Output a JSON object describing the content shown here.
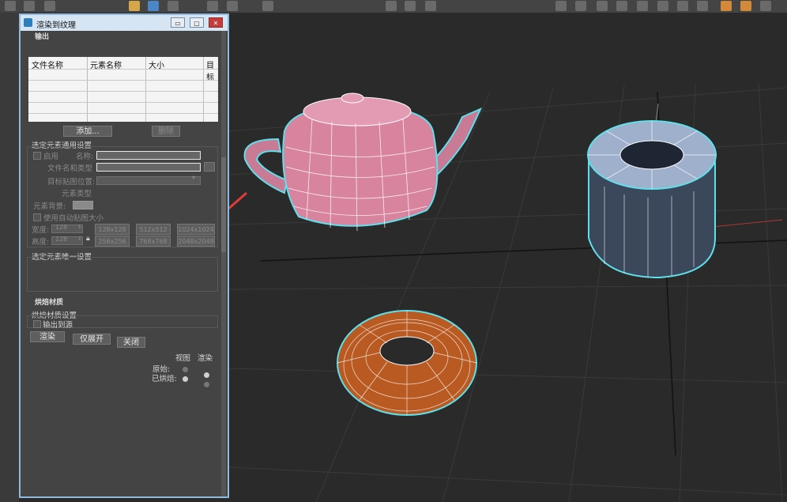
{
  "viewport": {
    "label": "[+]"
  },
  "dialog": {
    "title": "渲染到纹理",
    "minimize_glyph": "▭",
    "maximize_glyph": "▢",
    "close_glyph": "✕",
    "rollout_output": "输出",
    "table": {
      "headers": [
        "文件名称",
        "元素名称",
        "大小",
        "目标"
      ]
    },
    "add_button": "添加...",
    "delete_button": "删除",
    "common_settings": "选定元素通用设置",
    "enable_label": "启用",
    "name_label": "名称:",
    "file_name_type_label": "文件名和类型",
    "target_map_slot_label": "目标贴图位置:",
    "element_type_label": "元素类型",
    "element_bg_label": "元素背景:",
    "auto_map_size_label": "使用自动贴图大小",
    "width_label": "宽度:",
    "height_label": "高度:",
    "width_value": "128",
    "height_value": "128",
    "size_presets_row1": [
      "128x128",
      "512x512",
      "1024x1024"
    ],
    "size_presets_row2": [
      "256x256",
      "768x768",
      "2048x2048"
    ],
    "unique_settings": "选定元素唯一设置",
    "rollout_baked_material": "烘焙材质",
    "baked_material_settings": "烘焙材质设置",
    "output_to_source": "输出到源",
    "render_button": "渲染",
    "unwrap_only_button": "仅展开",
    "close_button": "关闭",
    "col_view": "视图",
    "col_render": "渲染",
    "row_original": "原始:",
    "row_baked": "已烘焙:"
  },
  "colors": {
    "accent": "#8fb9de",
    "selection_outline": "#5fe0ea",
    "teapot": "#d9849f",
    "torus": "#b95a22",
    "tube": "#9fb0cc",
    "arrow": "#e33a3a"
  }
}
